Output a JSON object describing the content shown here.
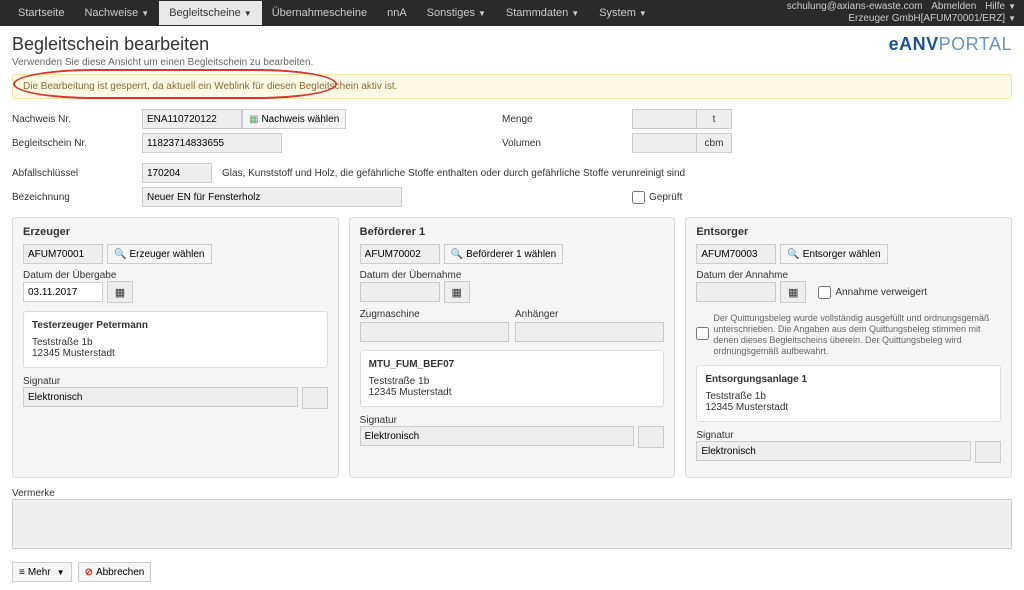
{
  "topbar": {
    "nav": [
      "Startseite",
      "Nachweise",
      "Begleitscheine",
      "Übernahmescheine",
      "nnA",
      "Sonstiges",
      "Stammdaten",
      "System"
    ],
    "active_index": 2,
    "user": "schulung@axians-ewaste.com",
    "logout": "Abmelden",
    "help": "Hilfe",
    "org": "Erzeuger GmbH[AFUM70001/ERZ]"
  },
  "brand": {
    "e": "e",
    "anv": "ANV",
    "portal": "PORTAL"
  },
  "page": {
    "title": "Begleitschein bearbeiten",
    "subtitle": "Verwenden Sie diese Ansicht um einen Begleitschein zu bearbeiten."
  },
  "alert": "Die Bearbeitung ist gesperrt, da aktuell ein Weblink für diesen Begleitschein aktiv ist.",
  "labels": {
    "nachweis_nr": "Nachweis Nr.",
    "begleitschein_nr": "Begleitschein Nr.",
    "abfallschluessel": "Abfallschlüssel",
    "bezeichnung": "Bezeichnung",
    "menge": "Menge",
    "volumen": "Volumen",
    "geprueft": "Geprüft",
    "nachweis_waehlen": "Nachweis wählen",
    "vermerke": "Vermerke",
    "mehr": "Mehr",
    "abbrechen": "Abbrechen"
  },
  "units": {
    "t": "t",
    "cbm": "cbm"
  },
  "values": {
    "nachweis_nr": "ENA110720122",
    "begleitschein_nr": "11823714833655",
    "abfallschluessel": "170204",
    "abfall_desc": "Glas, Kunststoff und Holz, die gefährliche Stoffe enthalten oder durch gefährliche Stoffe verunreinigt sind",
    "bezeichnung": "Neuer EN für Fensterholz",
    "menge": "",
    "volumen": ""
  },
  "erzeuger": {
    "title": "Erzeuger",
    "id": "AFUM70001",
    "select_btn": "Erzeuger wählen",
    "date_label": "Datum der Übergabe",
    "date": "03.11.2017",
    "addr_name": "Testerzeuger Petermann",
    "addr_street": "Teststraße 1b",
    "addr_city": "12345 Musterstadt",
    "sig_label": "Signatur",
    "sig_value": "Elektronisch"
  },
  "befoerderer": {
    "title": "Beförderer 1",
    "id": "AFUM70002",
    "select_btn": "Beförderer 1 wählen",
    "date_label": "Datum der Übernahme",
    "date": "",
    "zug_label": "Zugmaschine",
    "anh_label": "Anhänger",
    "addr_name": "MTU_FUM_BEF07",
    "addr_street": "Teststraße 1b",
    "addr_city": "12345 Musterstadt",
    "sig_label": "Signatur",
    "sig_value": "Elektronisch"
  },
  "entsorger": {
    "title": "Entsorger",
    "id": "AFUM70003",
    "select_btn": "Entsorger wählen",
    "date_label": "Datum der Annahme",
    "date": "",
    "annahme_verweigert": "Annahme verweigert",
    "quittung_text": "Der Quittungsbeleg wurde vollständig ausgefüllt und ordnungsgemäß unterschrieben. Die Angaben aus dem Quittungsbeleg stimmen mit denen dieses Begleitscheins überein. Der Quittungsbeleg wird ordnungsgemäß aufbewahrt.",
    "addr_name": "Entsorgungsanlage 1",
    "addr_street": "Teststraße 1b",
    "addr_city": "12345 Musterstadt",
    "sig_label": "Signatur",
    "sig_value": "Elektronisch"
  }
}
